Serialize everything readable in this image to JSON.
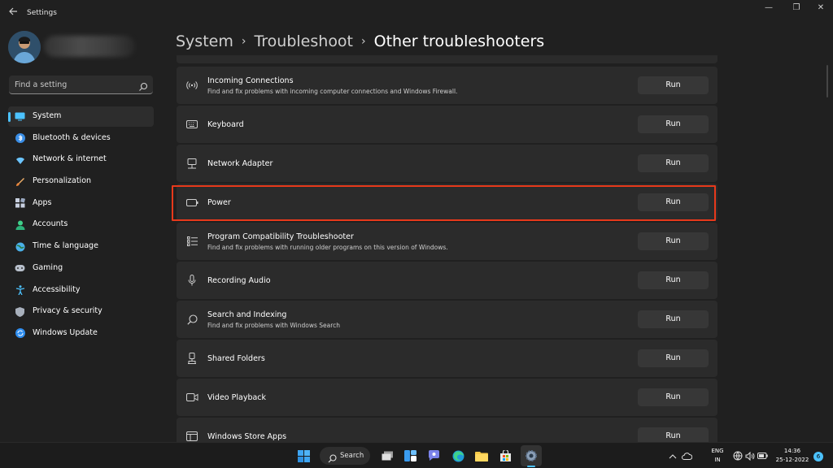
{
  "window": {
    "title": "Settings",
    "controls": {
      "minimize": "—",
      "maximize": "❐",
      "close": "✕"
    }
  },
  "sidebar": {
    "search": {
      "placeholder": "Find a setting"
    },
    "items": [
      {
        "label": "System",
        "icon": "system-icon",
        "active": true
      },
      {
        "label": "Bluetooth & devices",
        "icon": "bluetooth-icon"
      },
      {
        "label": "Network & internet",
        "icon": "network-icon"
      },
      {
        "label": "Personalization",
        "icon": "personalization-icon"
      },
      {
        "label": "Apps",
        "icon": "apps-icon"
      },
      {
        "label": "Accounts",
        "icon": "accounts-icon"
      },
      {
        "label": "Time & language",
        "icon": "time-language-icon"
      },
      {
        "label": "Gaming",
        "icon": "gaming-icon"
      },
      {
        "label": "Accessibility",
        "icon": "accessibility-icon"
      },
      {
        "label": "Privacy & security",
        "icon": "privacy-icon"
      },
      {
        "label": "Windows Update",
        "icon": "windows-update-icon"
      }
    ]
  },
  "breadcrumb": {
    "items": [
      "System",
      "Troubleshoot"
    ],
    "current": "Other troubleshooters"
  },
  "troubleshooters": [
    {
      "title": "Incoming Connections",
      "description": "Find and fix problems with incoming computer connections and Windows Firewall.",
      "action": "Run",
      "icon": "wifi-signal-icon"
    },
    {
      "title": "Keyboard",
      "description": "",
      "action": "Run",
      "icon": "keyboard-icon"
    },
    {
      "title": "Network Adapter",
      "description": "",
      "action": "Run",
      "icon": "network-adapter-icon"
    },
    {
      "title": "Power",
      "description": "",
      "action": "Run",
      "icon": "battery-icon",
      "highlighted": true
    },
    {
      "title": "Program Compatibility Troubleshooter",
      "description": "Find and fix problems with running older programs on this version of Windows.",
      "action": "Run",
      "icon": "program-list-icon"
    },
    {
      "title": "Recording Audio",
      "description": "",
      "action": "Run",
      "icon": "microphone-icon"
    },
    {
      "title": "Search and Indexing",
      "description": "Find and fix problems with Windows Search",
      "action": "Run",
      "icon": "search-icon"
    },
    {
      "title": "Shared Folders",
      "description": "",
      "action": "Run",
      "icon": "shared-folders-icon"
    },
    {
      "title": "Video Playback",
      "description": "",
      "action": "Run",
      "icon": "video-camera-icon"
    },
    {
      "title": "Windows Store Apps",
      "description": "",
      "action": "Run",
      "icon": "store-app-icon"
    }
  ],
  "taskbar": {
    "search_label": "Search",
    "language": {
      "line1": "ENG",
      "line2": "IN"
    },
    "time": "14:36",
    "date": "25-12-2022",
    "notifications": "6"
  },
  "colors": {
    "accent": "#4cc2ff",
    "highlight_border": "#e8391b",
    "card_bg": "#2b2b2b",
    "window_bg": "#202020"
  }
}
